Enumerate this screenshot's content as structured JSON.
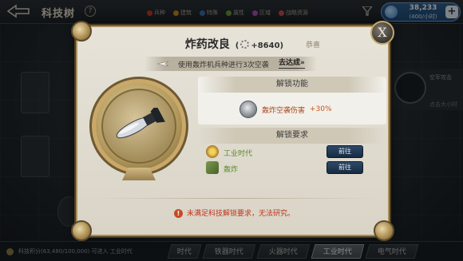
{
  "header": {
    "title": "科技树",
    "filters": [
      {
        "label": "兵种",
        "color": "#c23a2a"
      },
      {
        "label": "建筑",
        "color": "#c5862b"
      },
      {
        "label": "特殊",
        "color": "#3c6db0"
      },
      {
        "label": "属性",
        "color": "#6a9a3a"
      },
      {
        "label": "区域",
        "color": "#b04db5"
      },
      {
        "label": "战略资源",
        "color": "#c94b4b"
      }
    ],
    "resource": {
      "amount": "38,233",
      "rate": "(400/小时)"
    }
  },
  "modal": {
    "title": "炸药改良",
    "bonus": "+8640",
    "congrats": "恭喜",
    "close_label": "X",
    "task": {
      "text": "使用轰炸机兵种进行3次空袭",
      "link": "去达成»"
    },
    "unlock_function": {
      "heading": "解锁功能",
      "effect_name": "轰炸空袭伤害",
      "effect_value": "+30%"
    },
    "unlock_requirements": {
      "heading": "解锁要求",
      "items": [
        {
          "label": "工业时代",
          "button": "前往"
        },
        {
          "label": "轰炸",
          "button": "前往"
        }
      ]
    },
    "warning": "未满足科技解锁要求，无法研究。"
  },
  "background": {
    "side_card_title": "空军攻击",
    "side_card_sub": "点击大小时"
  },
  "footer": {
    "points": "科技积分(63,480/100,000)  可进入 工业时代",
    "eras": [
      {
        "label": "时代",
        "active": false
      },
      {
        "label": "铁器时代",
        "active": false
      },
      {
        "label": "火器时代",
        "active": false
      },
      {
        "label": "工业时代",
        "active": true
      },
      {
        "label": "电气时代",
        "active": false
      }
    ]
  }
}
